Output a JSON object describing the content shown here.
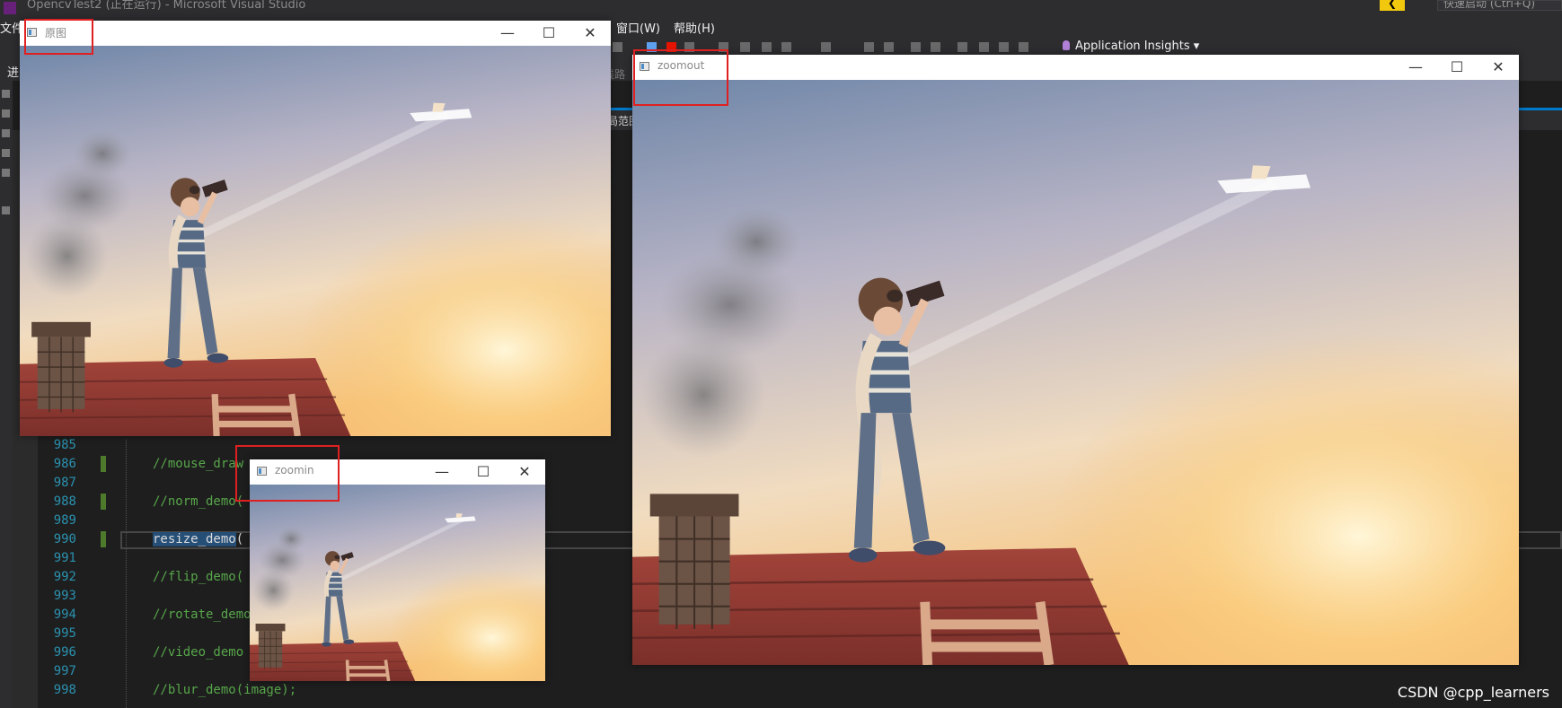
{
  "vs": {
    "window_title": "OpencvTest2 (正在运行) - Microsoft Visual Studio",
    "quick_launch": "快速启动 (Ctrl+Q)",
    "badge": "❮",
    "menu": {
      "file": "文件",
      "window": "窗口(W)",
      "help": "帮助(H)"
    },
    "app_insights": "Application Insights",
    "row2_label": "进",
    "toolbar_snippet": "线路",
    "tab_snippet": "局范围",
    "code": [
      {
        "num": "985",
        "text": ""
      },
      {
        "num": "986",
        "text": "//mouse_draw"
      },
      {
        "num": "987",
        "text": ""
      },
      {
        "num": "988",
        "text": "//norm_demo("
      },
      {
        "num": "989",
        "text": ""
      },
      {
        "num": "990",
        "text": "resize_demo",
        "rest": "("
      },
      {
        "num": "991",
        "text": ""
      },
      {
        "num": "992",
        "text": "//flip_demo("
      },
      {
        "num": "993",
        "text": ""
      },
      {
        "num": "994",
        "text": "//rotate_demo"
      },
      {
        "num": "995",
        "text": ""
      },
      {
        "num": "996",
        "text": "//video_demo"
      },
      {
        "num": "997",
        "text": ""
      },
      {
        "num": "998",
        "text": "//blur_demo(image);"
      }
    ]
  },
  "windows": {
    "original": {
      "title": "原图",
      "min": "—",
      "max": "☐",
      "close": "✕"
    },
    "zoomin": {
      "title": "zoomin",
      "min": "—",
      "max": "☐",
      "close": "✕"
    },
    "zoomout": {
      "title": "zoomout",
      "min": "—",
      "max": "☐",
      "close": "✕"
    }
  },
  "watermark": "CSDN @cpp_learners",
  "colors": {
    "vs_bg": "#1e1e1e",
    "highlight_box": "#e02020",
    "vs_accent": "#007acc"
  }
}
